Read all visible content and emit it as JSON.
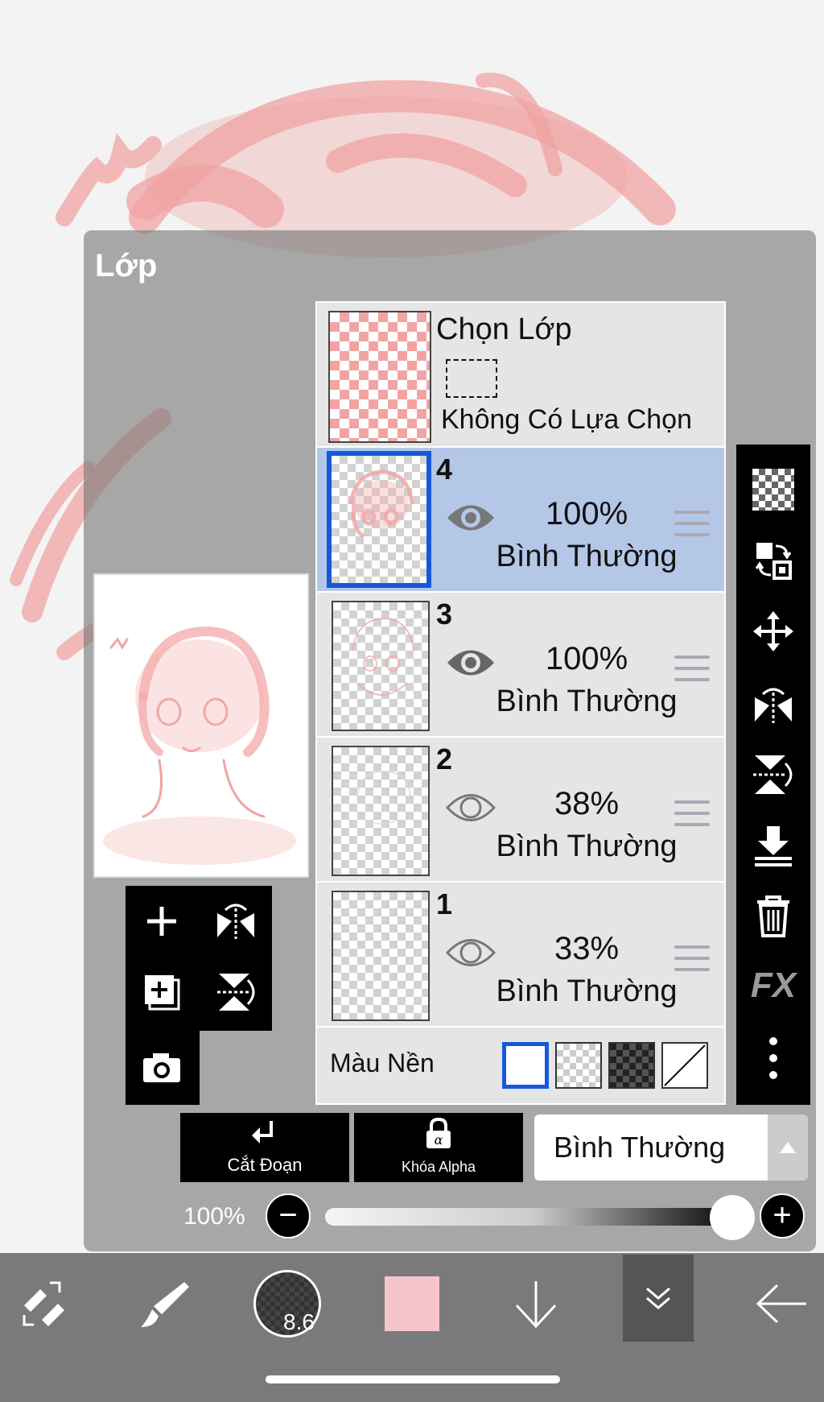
{
  "panel": {
    "title": "Lớp"
  },
  "selection_layer": {
    "title": "Chọn Lớp",
    "status": "Không Có Lựa Chọn"
  },
  "layers": [
    {
      "number": "4",
      "opacity": "100%",
      "blend": "Bình Thường",
      "visible": true,
      "selected": true
    },
    {
      "number": "3",
      "opacity": "100%",
      "blend": "Bình Thường",
      "visible": true,
      "selected": false
    },
    {
      "number": "2",
      "opacity": "38%",
      "blend": "Bình Thường",
      "visible": false,
      "selected": false
    },
    {
      "number": "1",
      "opacity": "33%",
      "blend": "Bình Thường",
      "visible": false,
      "selected": false
    }
  ],
  "background": {
    "label": "Màu Nền",
    "options": [
      "white",
      "checker-light",
      "checker-dark",
      "none"
    ],
    "selected": "white"
  },
  "right_tools": [
    "checker-icon",
    "transfer-icon",
    "move-icon",
    "flip-horizontal-icon",
    "flip-vertical-icon",
    "merge-down-icon",
    "trash-icon",
    "fx-icon",
    "more-icon"
  ],
  "fx_label": "FX",
  "left_tools": [
    "add-layer-icon",
    "flip-layer-h-icon",
    "add-copy-icon",
    "flip-layer-v-icon",
    "camera-icon"
  ],
  "actions": {
    "clip_label": "Cắt Đoạn",
    "alpha_label": "Khóa Alpha"
  },
  "blend_mode": {
    "value": "Bình Thường"
  },
  "opacity_slider": {
    "label": "100%",
    "value": 1.0
  },
  "toolbar": {
    "brush_size": "8.6",
    "current_color": "#f5c4cb"
  },
  "colors": {
    "accent": "#1459d9",
    "selected_row": "#b4c7e6",
    "sketch": "#f08a8a"
  }
}
